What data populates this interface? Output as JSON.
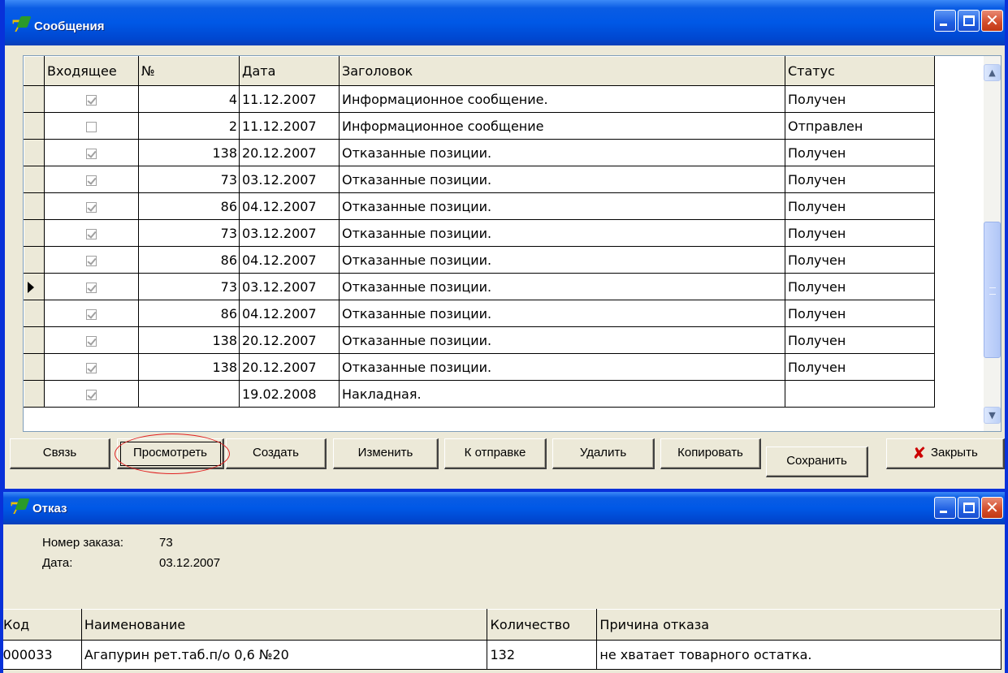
{
  "messages_window": {
    "title": "Сообщения",
    "columns": [
      "Входящее",
      "№",
      "Дата",
      "Заголовок",
      "Статус"
    ],
    "rows": [
      {
        "incoming": true,
        "num": "4",
        "date": "11.12.2007",
        "subject": "Информационное сообщение.",
        "status": "Получен"
      },
      {
        "incoming": false,
        "num": "2",
        "date": "11.12.2007",
        "subject": "Информационное сообщение",
        "status": "Отправлен"
      },
      {
        "incoming": true,
        "num": "138",
        "date": "20.12.2007",
        "subject": "Отказанные позиции.",
        "status": "Получен"
      },
      {
        "incoming": true,
        "num": "73",
        "date": "03.12.2007",
        "subject": "Отказанные позиции.",
        "status": "Получен"
      },
      {
        "incoming": true,
        "num": "86",
        "date": "04.12.2007",
        "subject": "Отказанные позиции.",
        "status": "Получен"
      },
      {
        "incoming": true,
        "num": "73",
        "date": "03.12.2007",
        "subject": "Отказанные позиции.",
        "status": "Получен"
      },
      {
        "incoming": true,
        "num": "86",
        "date": "04.12.2007",
        "subject": "Отказанные позиции.",
        "status": "Получен"
      },
      {
        "incoming": true,
        "num": "73",
        "date": "03.12.2007",
        "subject": "Отказанные позиции.",
        "status": "Получен",
        "current": true
      },
      {
        "incoming": true,
        "num": "86",
        "date": "04.12.2007",
        "subject": "Отказанные позиции.",
        "status": "Получен"
      },
      {
        "incoming": true,
        "num": "138",
        "date": "20.12.2007",
        "subject": "Отказанные позиции.",
        "status": "Получен"
      },
      {
        "incoming": true,
        "num": "138",
        "date": "20.12.2007",
        "subject": "Отказанные позиции.",
        "status": "Получен"
      },
      {
        "incoming": true,
        "num": "",
        "date": "19.02.2008",
        "subject": "Накладная.",
        "status": ""
      }
    ],
    "buttons": {
      "connect": "Связь",
      "view": "Просмотреть",
      "create": "Создать",
      "edit": "Изменить",
      "to_send": "К отправке",
      "delete": "Удалить",
      "copy": "Копировать",
      "save": "Сохранить",
      "close": "Закрыть"
    }
  },
  "refusal_window": {
    "title": "Отказ",
    "order_label": "Номер заказа:",
    "order_value": "73",
    "date_label": "Дата:",
    "date_value": "03.12.2007",
    "columns": [
      "Код",
      "Наименование",
      "Количество",
      "Причина отказа"
    ],
    "rows": [
      {
        "code": "000033",
        "name": "Агапурин рет.таб.п/о 0,6 №20",
        "qty": "132",
        "reason": "не хватает товарного остатка."
      }
    ]
  },
  "colors": {
    "titlebar": "#0058e6",
    "window_face": "#ece9d8",
    "highlight_oval": "#e02020",
    "close_x": "#cc0000"
  },
  "icons": {
    "app": "app-logo-icon",
    "minimize": "minimize-icon",
    "maximize": "maximize-icon",
    "close": "close-icon",
    "scroll_up": "chevron-up-icon",
    "scroll_down": "chevron-down-icon",
    "row_pointer": "row-pointer-icon",
    "close_button": "red-x-icon"
  }
}
